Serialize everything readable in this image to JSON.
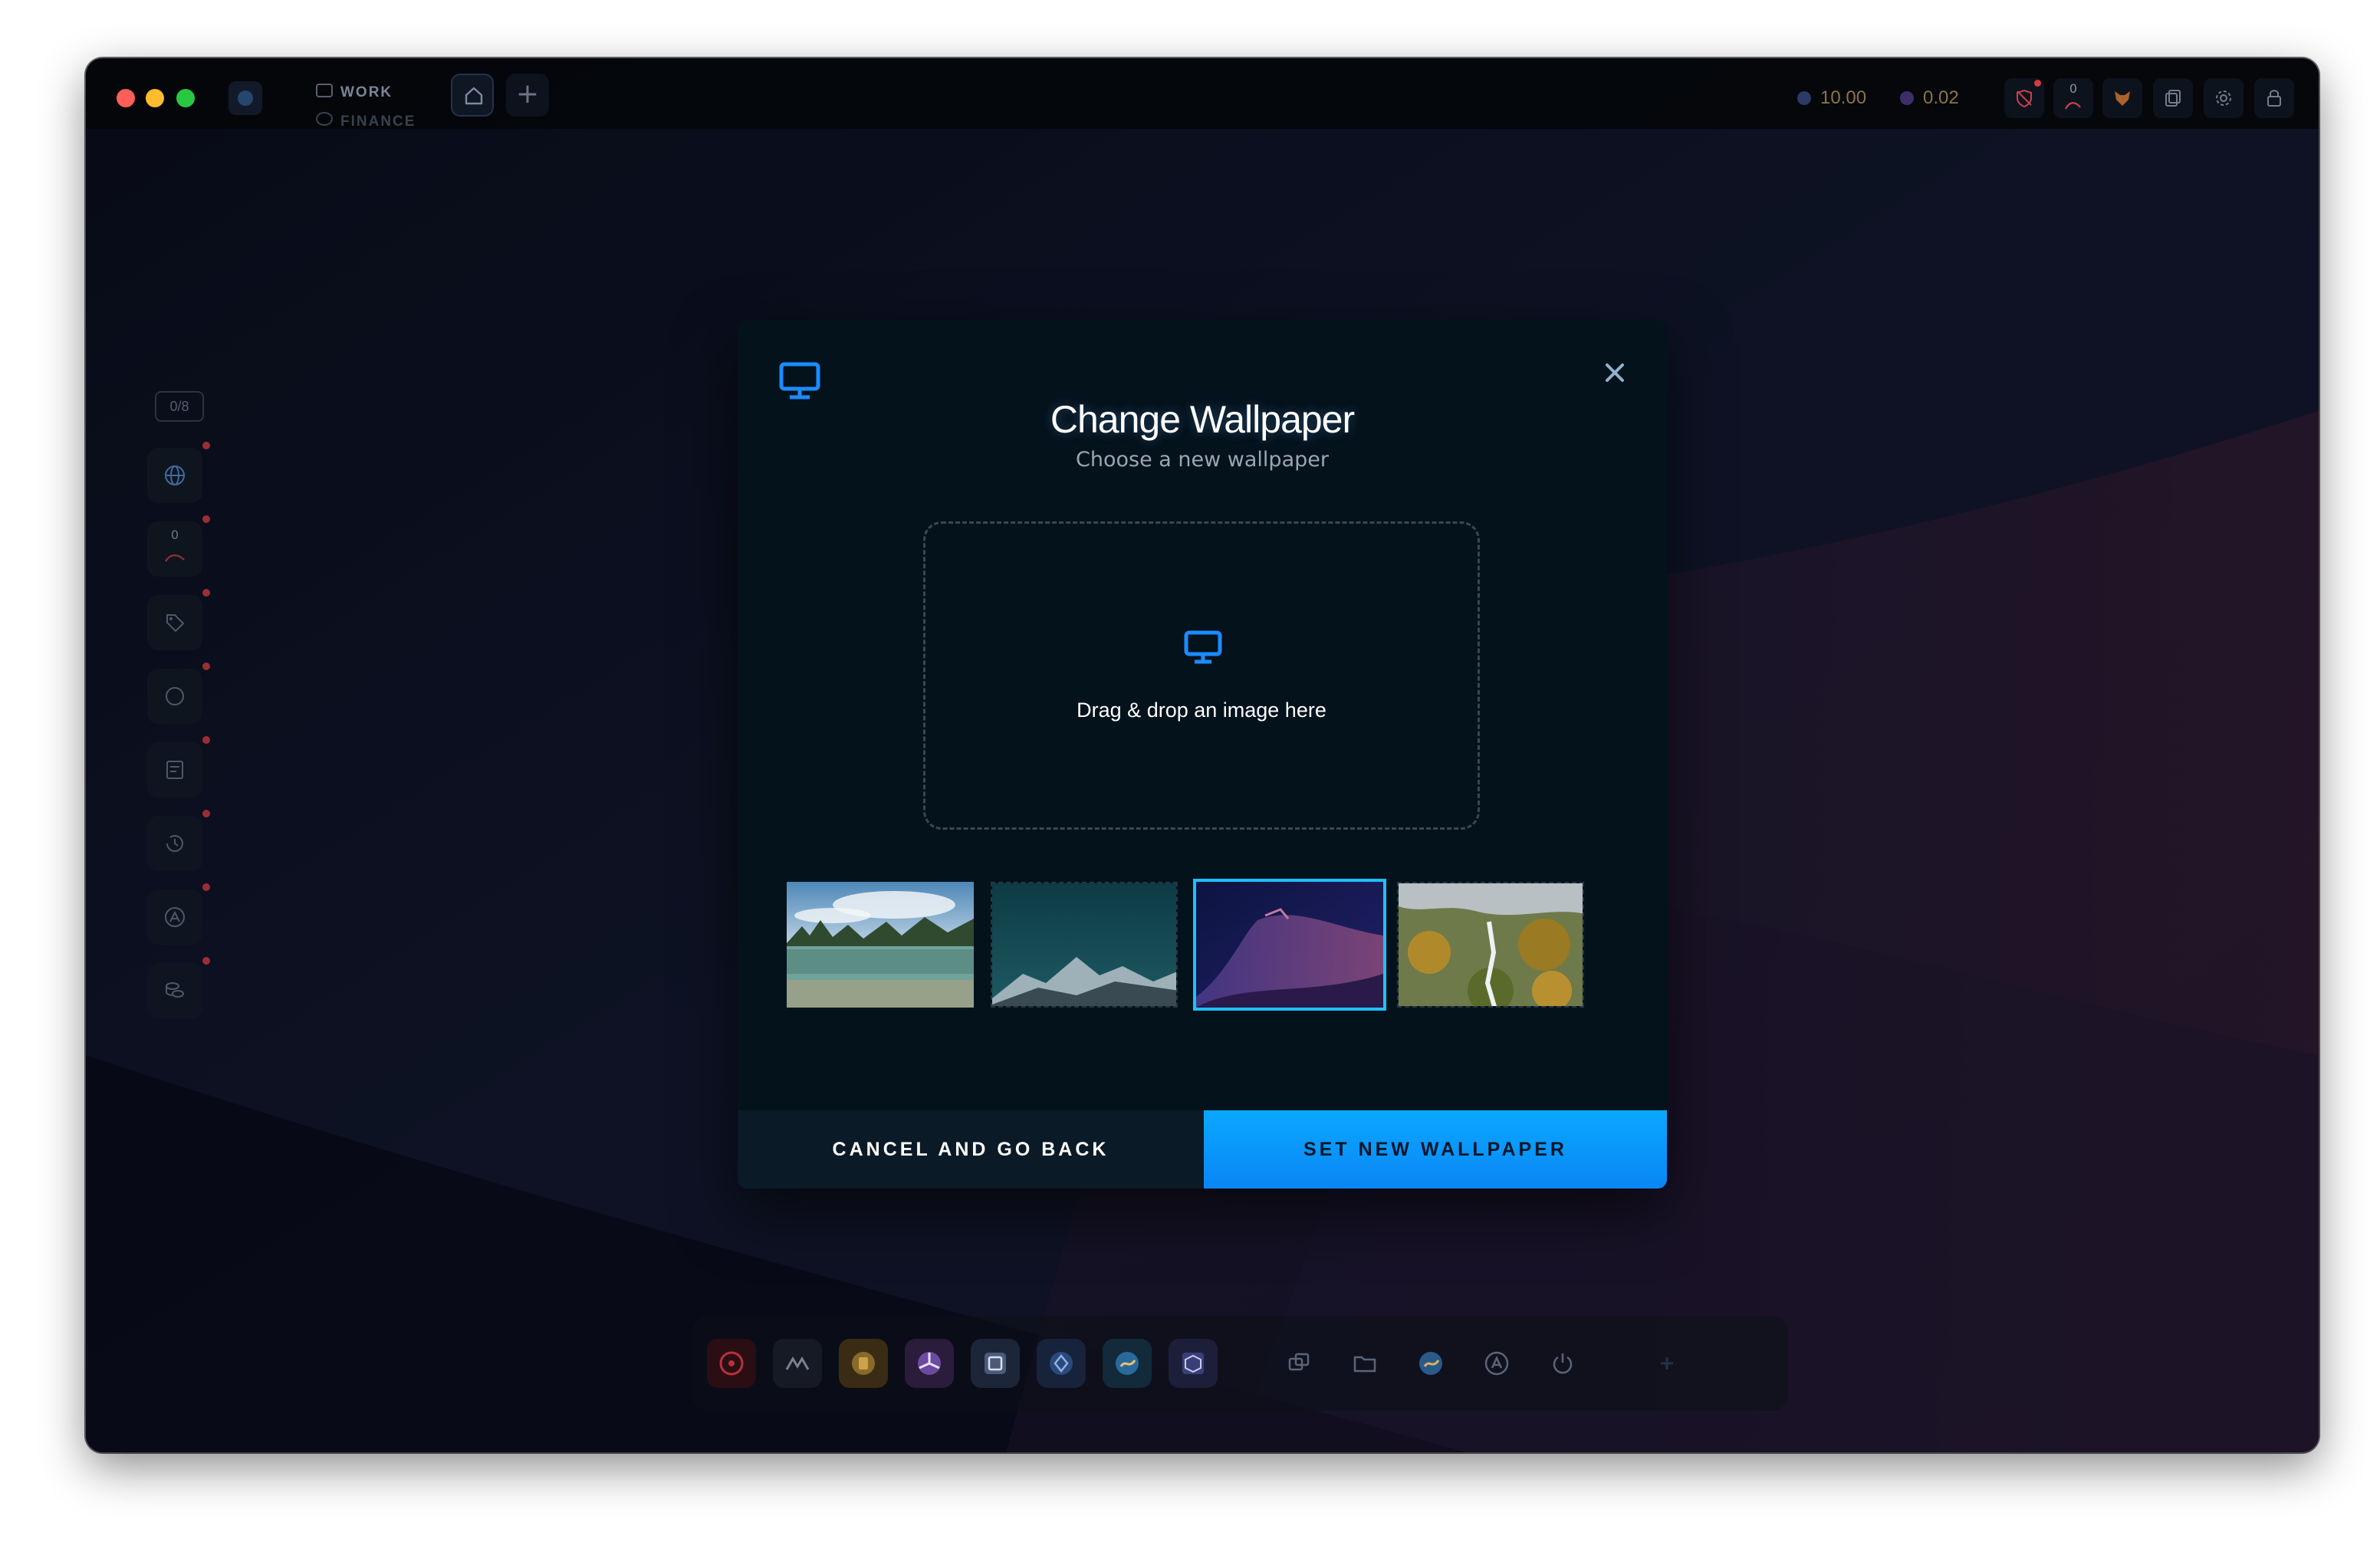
{
  "titlebar": {
    "workspaces": [
      {
        "label": "WORK"
      },
      {
        "label": "FINANCE"
      }
    ],
    "stats": [
      {
        "value": "10.00"
      },
      {
        "value": "0.02"
      }
    ],
    "notification_count": "0"
  },
  "sidebar": {
    "count": "0/8",
    "badge": "0"
  },
  "modal": {
    "title": "Change Wallpaper",
    "subtitle": "Choose a new wallpaper",
    "dropzone_text": "Drag & drop an image here",
    "cancel_label": "CANCEL AND GO BACK",
    "confirm_label": "SET NEW WALLPAPER",
    "selected_index": 2
  },
  "colors": {
    "accent": "#0a9cff",
    "selected_border": "#1ec0ff",
    "modal_bg": "#04121c"
  }
}
